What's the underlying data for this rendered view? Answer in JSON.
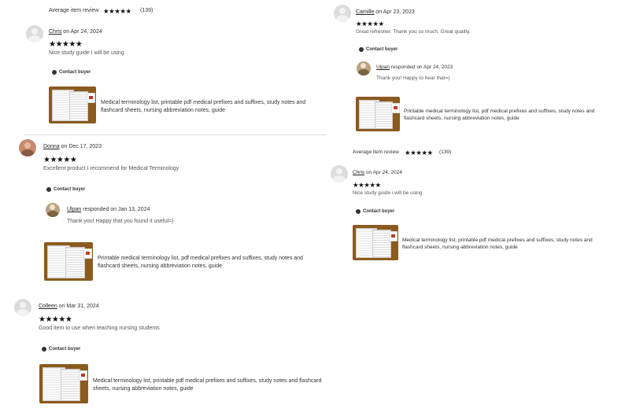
{
  "avg_label": "Average item review",
  "avg_count": "(139)",
  "stars": "★★★★★",
  "contact_buyer": "Contact buyer",
  "responded_on_1": "responded on Apr 24, 2023",
  "responded_on_2": "responded on Jan 13, 2024",
  "seller_name": "Ulpan",
  "left": {
    "r1": {
      "name": "Chris",
      "date": "on Apr 24, 2024",
      "text": "Nice study guide I will be using",
      "product": "Medical terminology list, printable pdf medical prefixes and suffixes, study notes and flashcard sheets, nursing abbreviation notes, guide"
    },
    "r2": {
      "name": "Donna",
      "date": "on Dec 17, 2023",
      "text": "Excellent product I recommend for Medical Terminology",
      "reply": "Thank you! Happy that you found it useful=)",
      "product": "Printable medical terminology list, pdf medical prefixes and suffixes, study notes and flashcard sheets, nursing abbreviation notes, guide"
    },
    "r3": {
      "name": "Colleen",
      "date": "on Mar 31, 2024",
      "text": "Good item to use when teaching nursing students",
      "product": "Medical terminology list, printable pdf medical prefixes and suffixes, study notes and flashcard sheets, nursing abbreviation notes, guide"
    }
  },
  "right": {
    "r1": {
      "name": "Camille",
      "date": "on Apr 23, 2023",
      "text": "Great refresher. Thank you so much. Great quality.",
      "reply": "Thank you! Happy to hear that=)",
      "product": "Printable medical terminology list, pdf medical prefixes and suffixes, study notes and flashcard sheets, nursing abbreviation notes, guide"
    },
    "r2": {
      "name": "Chris",
      "date": "on Apr 24, 2024",
      "text": "Nice study guide i will be using",
      "product": "Medical terminology list, printable pdf medical prefixes and suffixes, study notes and flashcard sheets, nursing abbreviation notes, guide"
    }
  }
}
